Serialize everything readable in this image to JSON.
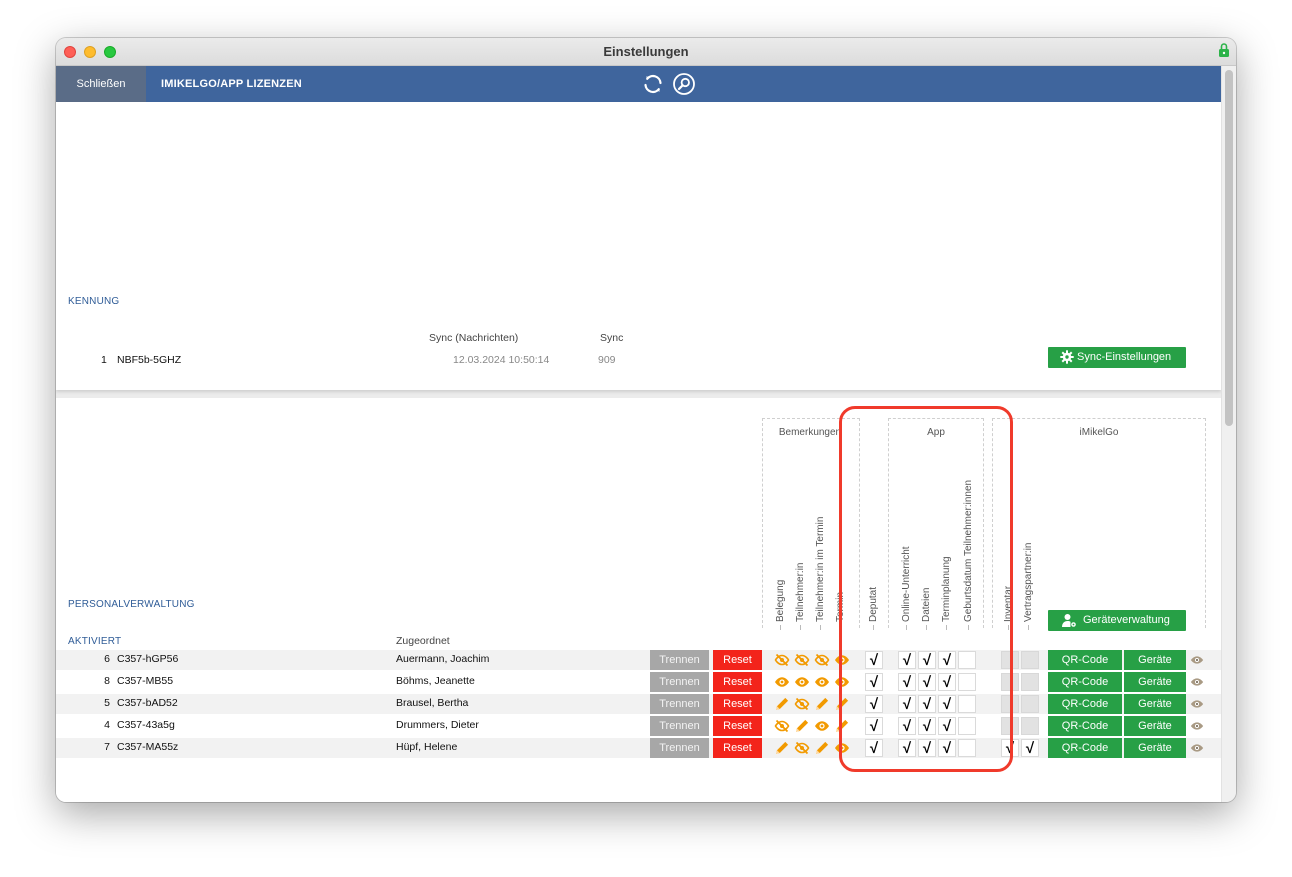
{
  "window": {
    "title": "Einstellungen"
  },
  "navbar": {
    "close_label": "Schließen",
    "licenses_label": "IMIKELGO/APP LIZENZEN",
    "sync_icon": "sync-icon",
    "search_icon": "search-icon"
  },
  "kennung": {
    "section_label": "KENNUNG",
    "headers": {
      "sync_messages": "Sync (Nachrichten)",
      "sync": "Sync"
    },
    "row": {
      "num": "1",
      "id": "NBF5b-5GHZ",
      "sync_messages": "12.03.2024 10:50:14",
      "sync": "909"
    },
    "sync_settings_label": "Sync-Einstellungen"
  },
  "personal": {
    "section_label": "PERSONALVERWALTUNG",
    "active_label": "AKTIVIERT",
    "assigned_header": "Zugeordnet",
    "groups": {
      "bemerkungen": "Bemerkungen",
      "app": "App",
      "imikelgo": "iMikelGo"
    },
    "columns": {
      "belegung": "Belegung",
      "teilnehmer": "Teilnehmer:in",
      "teilnehmer_termin": "Teilnehmer:in im Termin",
      "termin": "Termin",
      "deputat": "Deputat",
      "online": "Online-Unterricht",
      "dateien": "Dateien",
      "terminplanung": "Terminplanung",
      "geburtsdatum": "Geburtsdatum Teilnehmer:innen",
      "inventar": "Inventar",
      "vertragspartner": "Vertragspartner:in"
    },
    "geraeteverwaltung_label": "Geräteverwaltung",
    "buttons": {
      "trennen": "Trennen",
      "reset": "Reset",
      "qr": "QR-Code",
      "geraete": "Geräte"
    },
    "checkmark": "√",
    "rows": [
      {
        "num": "6",
        "id": "C357-hGP56",
        "name": "Auermann, Joachim",
        "icons": [
          "eye-off",
          "eye-off",
          "eye-off",
          "eye"
        ],
        "deputat": true,
        "online": true,
        "dateien": true,
        "terminplanung": true,
        "geburtsdatum": false,
        "inventar": false,
        "vertragspartner": false
      },
      {
        "num": "8",
        "id": "C357-MB55",
        "name": "Böhms, Jeanette",
        "icons": [
          "eye",
          "eye",
          "eye",
          "eye"
        ],
        "deputat": true,
        "online": true,
        "dateien": true,
        "terminplanung": true,
        "geburtsdatum": false,
        "inventar": false,
        "vertragspartner": false
      },
      {
        "num": "5",
        "id": "C357-bAD52",
        "name": "Brausel, Bertha",
        "icons": [
          "pencil",
          "eye-off",
          "pencil",
          "pencil"
        ],
        "deputat": true,
        "online": true,
        "dateien": true,
        "terminplanung": true,
        "geburtsdatum": false,
        "inventar": false,
        "vertragspartner": false
      },
      {
        "num": "4",
        "id": "C357-43a5g",
        "name": "Drummers, Dieter",
        "icons": [
          "eye-off",
          "pencil",
          "eye",
          "pencil"
        ],
        "deputat": true,
        "online": true,
        "dateien": true,
        "terminplanung": true,
        "geburtsdatum": false,
        "inventar": false,
        "vertragspartner": false
      },
      {
        "num": "7",
        "id": "C357-MA55z",
        "name": "Hüpf, Helene",
        "icons": [
          "pencil",
          "eye-off",
          "pencil",
          "eye"
        ],
        "deputat": true,
        "online": true,
        "dateien": true,
        "terminplanung": true,
        "geburtsdatum": false,
        "inventar": true,
        "vertragspartner": true
      }
    ]
  },
  "colors": {
    "navbar": "#3f659d",
    "green": "#27a046",
    "red": "#f3241b",
    "orange": "#f29a00",
    "highlight": "#f03a2b"
  }
}
